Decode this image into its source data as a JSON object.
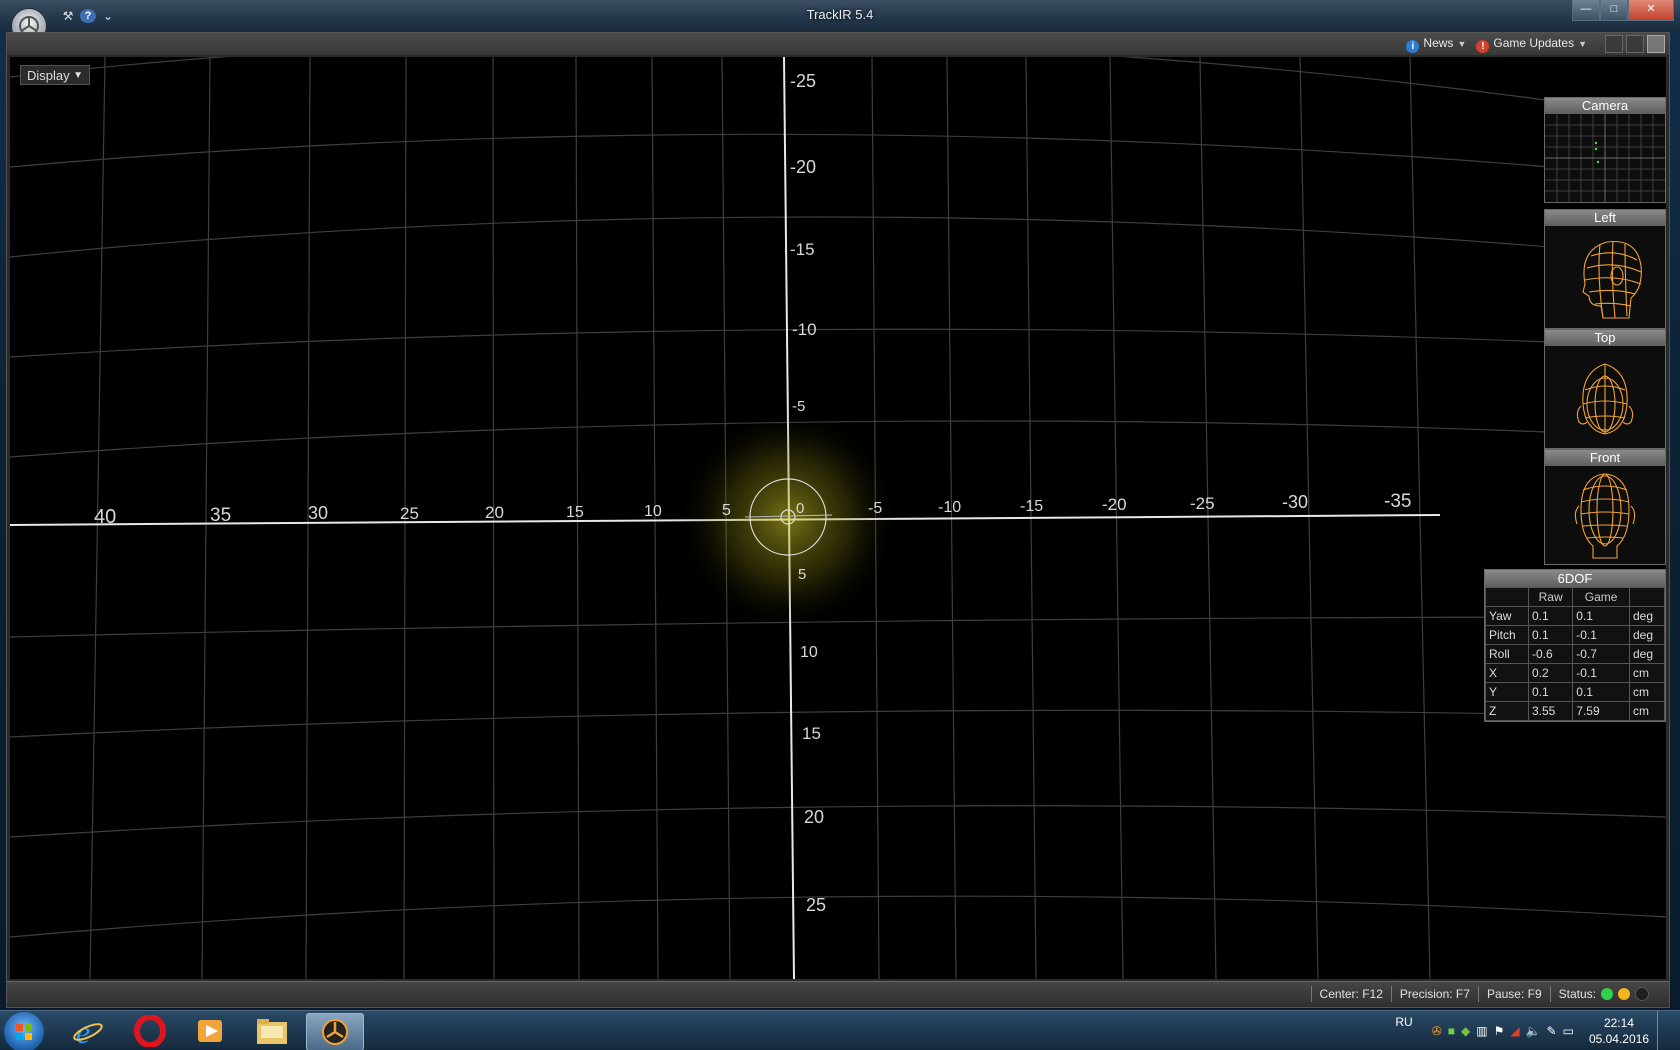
{
  "window": {
    "title": "TrackIR 5.4",
    "minimize": "—",
    "maximize": "□",
    "close": "✕"
  },
  "menubar": {
    "news_label": "News",
    "game_updates_label": "Game Updates"
  },
  "viewport": {
    "display_dropdown": "Display",
    "x_axis_labels": [
      "40",
      "35",
      "30",
      "25",
      "20",
      "15",
      "10",
      "5",
      "0",
      "-5",
      "-10",
      "-15",
      "-20",
      "-25",
      "-30",
      "-35"
    ],
    "y_axis_labels": [
      "-25",
      "-20",
      "-15",
      "-10",
      "-5",
      "5",
      "10",
      "15",
      "20",
      "25"
    ]
  },
  "panels": {
    "camera": "Camera",
    "left": "Left",
    "top": "Top",
    "front": "Front"
  },
  "dof": {
    "title": "6DOF",
    "col_raw": "Raw",
    "col_game": "Game",
    "rows": [
      {
        "label": "Yaw",
        "raw": "0.1",
        "game": "0.1",
        "unit": "deg"
      },
      {
        "label": "Pitch",
        "raw": "0.1",
        "game": "-0.1",
        "unit": "deg"
      },
      {
        "label": "Roll",
        "raw": "-0.6",
        "game": "-0.7",
        "unit": "deg"
      },
      {
        "label": "X",
        "raw": "0.2",
        "game": "-0.1",
        "unit": "cm"
      },
      {
        "label": "Y",
        "raw": "0.1",
        "game": "0.1",
        "unit": "cm"
      },
      {
        "label": "Z",
        "raw": "3.55",
        "game": "7.59",
        "unit": "cm"
      }
    ]
  },
  "statusbar": {
    "center": "Center: F12",
    "precision": "Precision: F7",
    "pause": "Pause: F9",
    "status": "Status:",
    "led_colors": [
      "#2fd24a",
      "#f2b51c",
      "#1f1f1f"
    ]
  },
  "taskbar": {
    "lang": "RU",
    "time": "22:14",
    "date": "05.04.2016"
  },
  "colors": {
    "accent_orange": "#f0a232",
    "glow_yellow": "#d9d12a"
  }
}
